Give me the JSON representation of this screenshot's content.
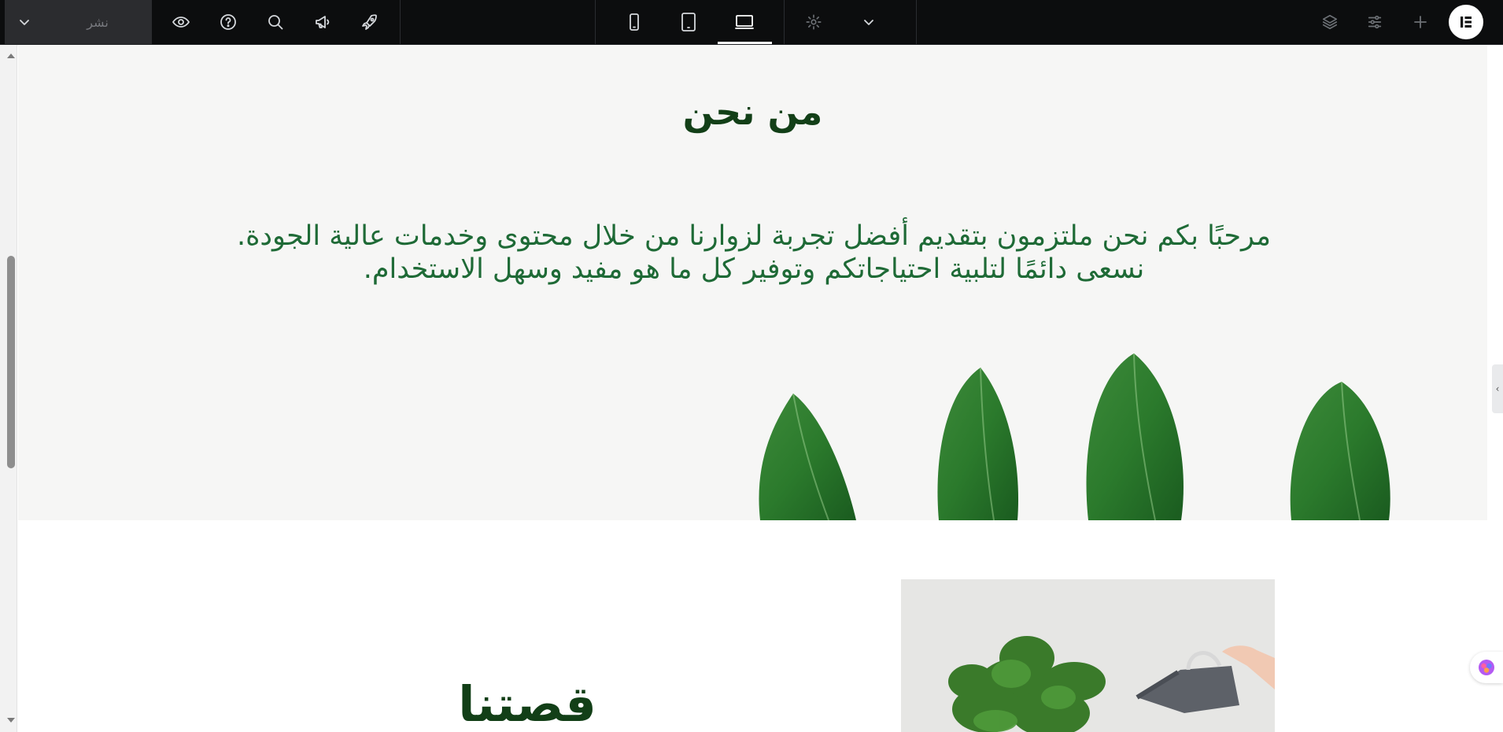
{
  "toolbar": {
    "publish_label": "نشر",
    "icons": {
      "publish_menu": "chevron-down-icon",
      "preview": "eye-icon",
      "help": "question-circle-icon",
      "search": "search-icon",
      "announcements": "megaphone-icon",
      "launch": "rocket-icon",
      "device_mobile": "mobile-icon",
      "device_tablet": "tablet-icon",
      "device_desktop": "desktop-icon",
      "settings": "gear-icon",
      "more": "chevron-down-icon",
      "structure": "layers-icon",
      "site_settings": "sliders-icon",
      "add": "plus-icon",
      "app": "elementor-logo-icon"
    },
    "active_device": "desktop"
  },
  "page": {
    "about": {
      "title": "من نحن",
      "paragraph": "مرحبًا بكم نحن ملتزمون بتقديم أفضل تجربة لزوارنا من خلال محتوى وخدمات عالية الجودة. نسعى دائمًا لتلبية احتياجاتكم وتوفير كل ما هو مفيد وسهل الاستخدام."
    },
    "story": {
      "title": "قصتنا"
    }
  },
  "colors": {
    "toolbar_bg": "#0c0d0e",
    "heading_green": "#123f17",
    "text_green": "#1e6a36",
    "section_bg": "#f6f6f5"
  }
}
